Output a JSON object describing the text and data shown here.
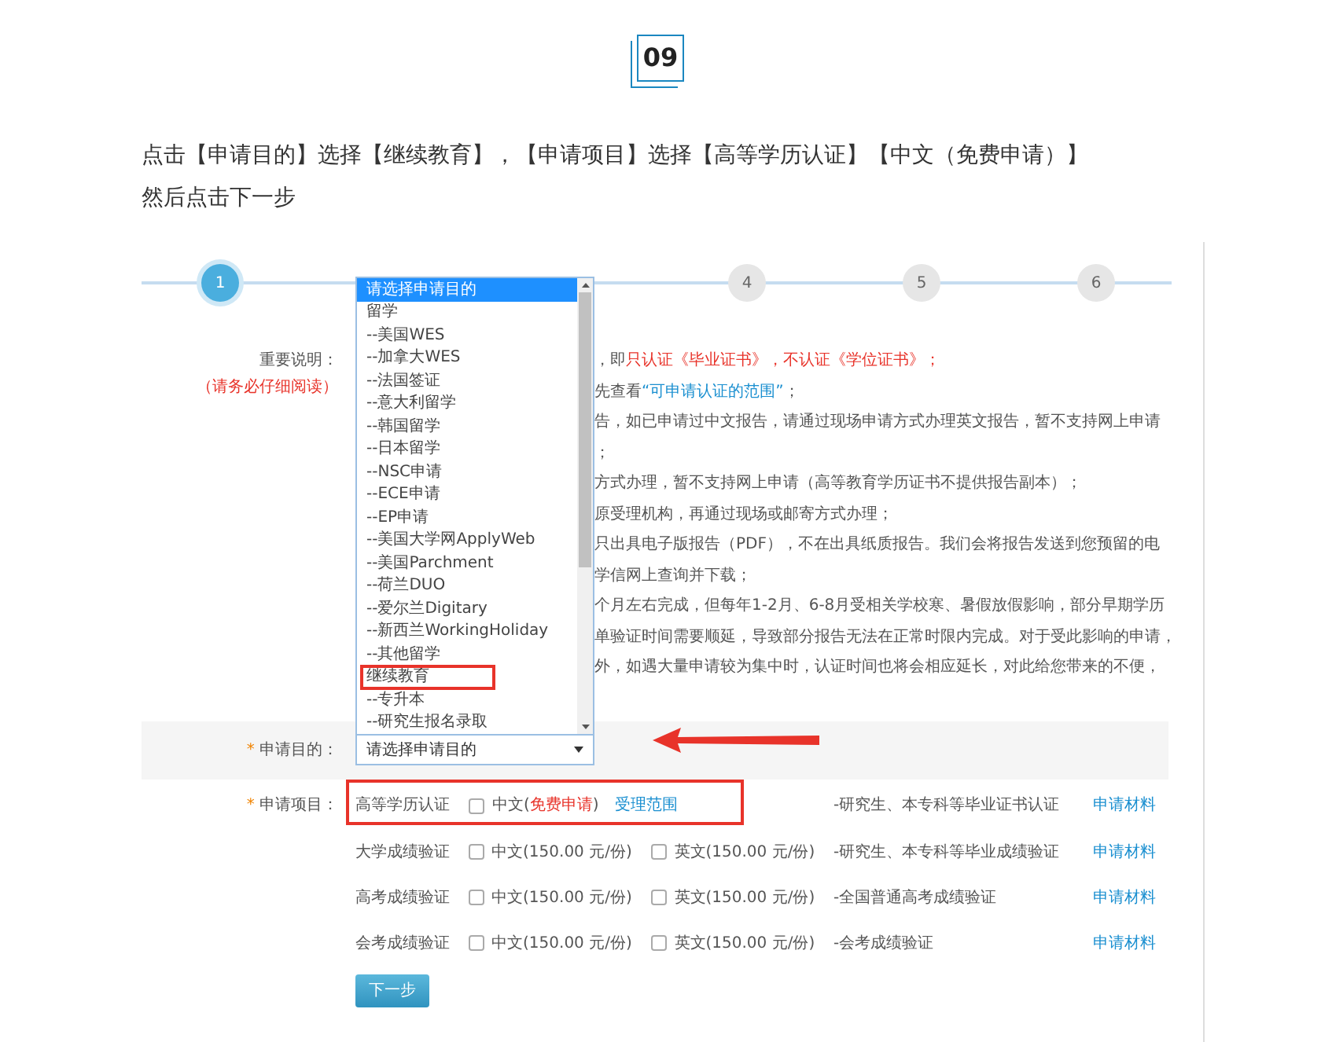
{
  "badge": "09",
  "instruction": [
    "点击【申请目的】选择【继续教育】，【申请项目】选择【高等学历认证】【中文（免费申请）】",
    "然后点击下一步"
  ],
  "steps": [
    {
      "label": "1",
      "selected": true
    },
    {
      "label": "4",
      "selected": false
    },
    {
      "label": "5",
      "selected": false
    },
    {
      "label": "6",
      "selected": false
    }
  ],
  "notice": {
    "label": "重要说明：",
    "hint": "（请务必仔细阅读）",
    "lines": [
      [
        {
          "text": "，即",
          "kind": "plain"
        },
        {
          "text": "只认证《毕业证书》，不认证《学位证书》；",
          "kind": "alert"
        }
      ],
      [
        {
          "text": "先查看",
          "kind": "plain"
        },
        {
          "text": "“可申请认证的范围”",
          "kind": "link"
        },
        {
          "text": "；",
          "kind": "plain"
        }
      ],
      [
        {
          "text": "告，如已申请过中文报告，请通过现场申请方式办理英文报告，暂不支持网上申请",
          "kind": "plain"
        }
      ],
      [
        {
          "text": "；",
          "kind": "plain"
        }
      ],
      [
        {
          "text": "方式办理，暂不支持网上申请（高等教育学历证书不提供报告副本）；",
          "kind": "plain"
        }
      ],
      [
        {
          "text": "原受理机构，再通过现场或邮寄方式办理；",
          "kind": "plain"
        }
      ],
      [
        {
          "text": "只出具电子版报告（PDF），不在出具纸质报告。我们会将报告发送到您预留的电",
          "kind": "plain"
        }
      ],
      [
        {
          "text": "学信网上查询并下载；",
          "kind": "plain"
        }
      ],
      [
        {
          "text": "个月左右完成，但每年1-2月、6-8月受相关学校寒、暑假放假影响，部分早期学历",
          "kind": "plain"
        }
      ],
      [
        {
          "text": "单验证时间需要顺延，导致部分报告无法在正常时限内完成。对于受此影响的申请，",
          "kind": "plain"
        }
      ],
      [
        {
          "text": "外，如遇大量申请较为集中时，认证时间也将会相应延长，对此给您带来的不便，",
          "kind": "plain"
        }
      ]
    ]
  },
  "purpose": {
    "label": "申请目的：",
    "required_mark": "*",
    "select": {
      "value": "请选择申请目的",
      "options": [
        {
          "text": "请选择申请目的",
          "selected": true,
          "annotated": false
        },
        {
          "text": "留学",
          "selected": false,
          "annotated": false
        },
        {
          "text": "--美国WES",
          "selected": false,
          "annotated": false
        },
        {
          "text": "--加拿大WES",
          "selected": false,
          "annotated": false
        },
        {
          "text": "--法国签证",
          "selected": false,
          "annotated": false
        },
        {
          "text": "--意大利留学",
          "selected": false,
          "annotated": false
        },
        {
          "text": "--韩国留学",
          "selected": false,
          "annotated": false
        },
        {
          "text": "--日本留学",
          "selected": false,
          "annotated": false
        },
        {
          "text": "--NSC申请",
          "selected": false,
          "annotated": false
        },
        {
          "text": "--ECE申请",
          "selected": false,
          "annotated": false
        },
        {
          "text": "--EP申请",
          "selected": false,
          "annotated": false
        },
        {
          "text": "--美国大学网ApplyWeb",
          "selected": false,
          "annotated": false
        },
        {
          "text": "--美国Parchment",
          "selected": false,
          "annotated": false
        },
        {
          "text": "--荷兰DUO",
          "selected": false,
          "annotated": false
        },
        {
          "text": "--爱尔兰Digitary",
          "selected": false,
          "annotated": false
        },
        {
          "text": "--新西兰WorkingHoliday",
          "selected": false,
          "annotated": false
        },
        {
          "text": "--其他留学",
          "selected": false,
          "annotated": false
        },
        {
          "text": "继续教育",
          "selected": false,
          "annotated": true
        },
        {
          "text": "--专升本",
          "selected": false,
          "annotated": false
        },
        {
          "text": "--研究生报名录取",
          "selected": false,
          "annotated": false
        }
      ]
    }
  },
  "projects": {
    "label": "申请项目：",
    "required_mark": "*",
    "rows": [
      {
        "name": "高等学历认证",
        "annotated": true,
        "options": [
          {
            "parts": [
              {
                "text": "中文(",
                "kind": "plain"
              },
              {
                "text": "免费申请",
                "kind": "alert"
              },
              {
                "text": ")",
                "kind": "plain"
              }
            ],
            "checked": false
          }
        ],
        "scope_link": "受理范围",
        "description": "-研究生、本专科等毕业证书认证",
        "materials_link": "申请材料"
      },
      {
        "name": "大学成绩验证",
        "annotated": false,
        "options": [
          {
            "parts": [
              {
                "text": "中文(150.00 元/份)",
                "kind": "plain"
              }
            ],
            "checked": false
          },
          {
            "parts": [
              {
                "text": "英文(150.00 元/份)",
                "kind": "plain"
              }
            ],
            "checked": false
          }
        ],
        "description": "-研究生、本专科等毕业成绩验证",
        "materials_link": "申请材料"
      },
      {
        "name": "高考成绩验证",
        "annotated": false,
        "options": [
          {
            "parts": [
              {
                "text": "中文(150.00 元/份)",
                "kind": "plain"
              }
            ],
            "checked": false
          },
          {
            "parts": [
              {
                "text": "英文(150.00 元/份)",
                "kind": "plain"
              }
            ],
            "checked": false
          }
        ],
        "description": "-全国普通高考成绩验证",
        "materials_link": "申请材料"
      },
      {
        "name": "会考成绩验证",
        "annotated": false,
        "options": [
          {
            "parts": [
              {
                "text": "中文(150.00 元/份)",
                "kind": "plain"
              }
            ],
            "checked": false
          },
          {
            "parts": [
              {
                "text": "英文(150.00 元/份)",
                "kind": "plain"
              }
            ],
            "checked": false
          }
        ],
        "description": "-会考成绩验证",
        "materials_link": "申请材料"
      }
    ]
  },
  "next_button": "下一步"
}
